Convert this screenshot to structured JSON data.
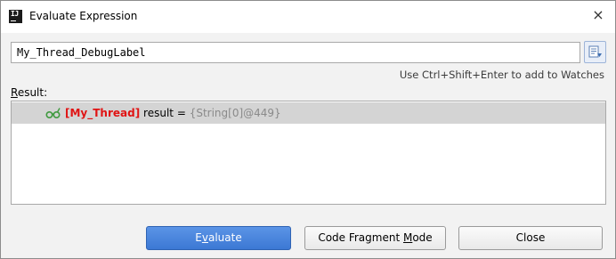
{
  "window": {
    "title": "Evaluate Expression",
    "app_icon_letters": "IJ",
    "close_glyph": "×"
  },
  "expression": {
    "value": "My_Thread_DebugLabel"
  },
  "hint": "Use Ctrl+Shift+Enter to add to Watches",
  "result": {
    "label_mnemonic": "R",
    "label_rest": "esult:",
    "row": {
      "icon": "watch-glasses-icon",
      "thread_label": "[My_Thread]",
      "name": "result",
      "equals": " = ",
      "value": "{String[0]@449}"
    }
  },
  "buttons": {
    "evaluate": {
      "pre": "E",
      "mnemonic": "v",
      "post": "aluate"
    },
    "code_fragment": {
      "pre": "Code Fragment ",
      "mnemonic": "M",
      "post": "ode"
    },
    "close": "Close"
  },
  "colors": {
    "thread_label": "#e01414",
    "value": "#8a8a8a",
    "primary_button": "#3c78d4",
    "selected_row": "#d4d4d4"
  }
}
